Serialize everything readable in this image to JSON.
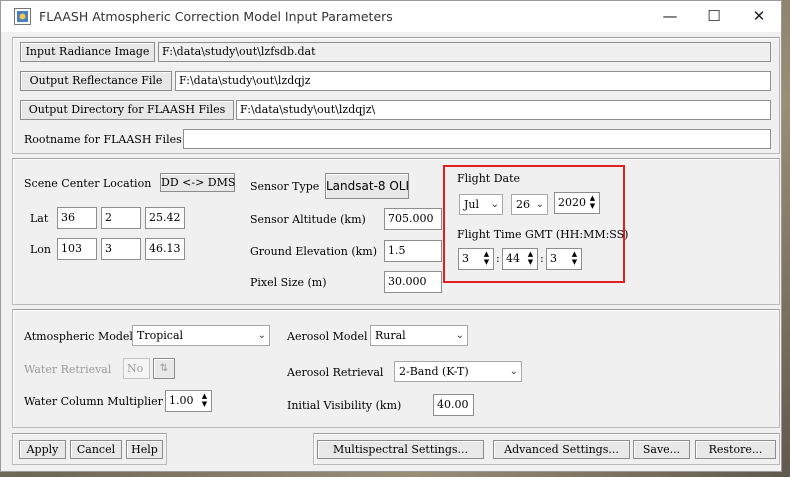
{
  "window": {
    "title": "FLAASH Atmospheric Correction Model Input Parameters",
    "minimize": "—",
    "maximize": "☐",
    "close": "✕"
  },
  "files": {
    "input_radiance_label": "Input Radiance Image",
    "input_radiance_value": "F:\\data\\study\\out\\lzfsdb.dat",
    "output_reflectance_label": "Output Reflectance File",
    "output_reflectance_value": "F:\\data\\study\\out\\lzdqjz",
    "output_dir_label": "Output Directory for FLAASH Files",
    "output_dir_value": "F:\\data\\study\\out\\lzdqjz\\",
    "rootname_label": "Rootname for FLAASH Files",
    "rootname_value": ""
  },
  "scene": {
    "center_label": "Scene Center Location",
    "ddms_button": "DD <-> DMS",
    "lat_label": "Lat",
    "lat_deg": "36",
    "lat_min": "2",
    "lat_sec": "25.42",
    "lon_label": "Lon",
    "lon_deg": "103",
    "lon_min": "3",
    "lon_sec": "46.13"
  },
  "sensor": {
    "type_label": "Sensor Type",
    "type_value": "Landsat-8 OLI",
    "altitude_label": "Sensor Altitude (km)",
    "altitude_value": "705.000",
    "ground_label": "Ground Elevation (km)",
    "ground_value": "1.5",
    "pixel_label": "Pixel Size (m)",
    "pixel_value": "30.000"
  },
  "flight": {
    "date_label": "Flight Date",
    "month": "Jul",
    "day": "26",
    "year": "2020",
    "time_label": "Flight Time GMT (HH:MM:SS)",
    "hh": "3",
    "mm": "44",
    "ss": "3",
    "sep": ":"
  },
  "model": {
    "atm_label": "Atmospheric Model",
    "atm_value": "Tropical",
    "water_label": "Water Retrieval",
    "water_value": "No",
    "multiplier_label": "Water Column Multiplier",
    "multiplier_value": "1.00",
    "aerosol_label": "Aerosol Model",
    "aerosol_value": "Rural",
    "retrieval_label": "Aerosol Retrieval",
    "retrieval_value": "2-Band (K-T)",
    "visibility_label": "Initial Visibility (km)",
    "visibility_value": "40.00"
  },
  "footer": {
    "apply": "Apply",
    "cancel": "Cancel",
    "help": "Help",
    "multispectral": "Multispectral Settings...",
    "advanced": "Advanced Settings...",
    "save": "Save...",
    "restore": "Restore..."
  },
  "colors": {
    "highlight_box": "#e02020",
    "dialog_bg": "#f0f0f0"
  },
  "icons": {
    "app": "flaash-app-icon",
    "chevron": "chevron-down-icon",
    "spin": "spin-arrows-icon",
    "toggle": "toggle-arrows-icon"
  }
}
